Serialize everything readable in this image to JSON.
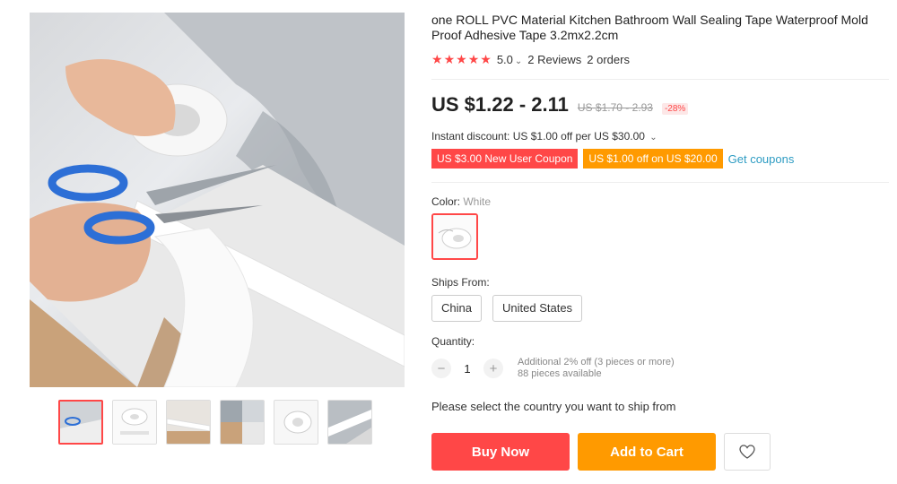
{
  "product": {
    "title": "one ROLL PVC Material Kitchen Bathroom Wall Sealing Tape Waterproof Mold Proof Adhesive Tape 3.2mx2.2cm"
  },
  "rating": {
    "stars": 5,
    "score": "5.0",
    "reviews": "2 Reviews",
    "orders": "2 orders",
    "star_color": "#ff4747"
  },
  "price": {
    "current": "US $1.22 - 2.11",
    "original": "US $1.70 - 2.93",
    "discount": "-28%"
  },
  "instant_discount": "Instant discount: US $1.00 off per US $30.00",
  "coupons": {
    "new_user": "US $3.00 New User Coupon",
    "off": "US $1.00 off on US $20.00",
    "get": "Get coupons"
  },
  "color": {
    "label": "Color:",
    "value": "White"
  },
  "ships_from": {
    "label": "Ships From:",
    "options": [
      "China",
      "United States"
    ]
  },
  "quantity": {
    "label": "Quantity:",
    "minus": "−",
    "value": "1",
    "plus": "+",
    "additional": "Additional 2% off (3 pieces or more)",
    "available": "88 pieces available"
  },
  "ship_message": "Please select the country you want to ship from",
  "actions": {
    "buy_now": "Buy Now",
    "add_to_cart": "Add to Cart",
    "wishlist_icon": "heart-icon"
  },
  "colors": {
    "primary_red": "#ff4747",
    "orange": "#ff9a00",
    "link_blue": "#2e9cc3"
  }
}
